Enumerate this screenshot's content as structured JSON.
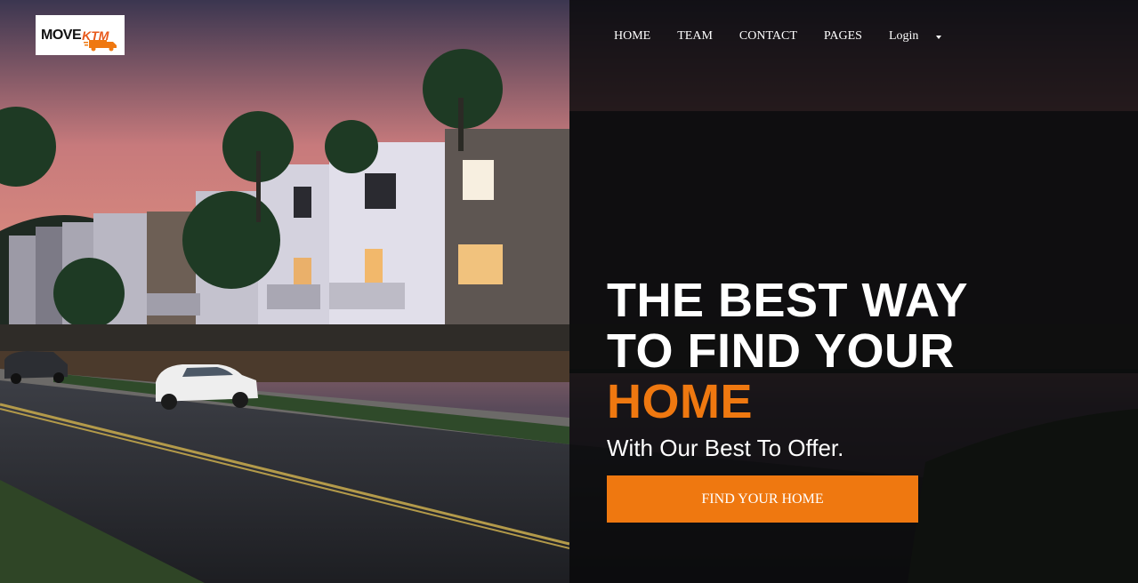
{
  "brand": {
    "logo_left": "MOVE",
    "logo_right": "KTM"
  },
  "nav": {
    "items": [
      "HOME",
      "TEAM",
      "CONTACT",
      "PAGES",
      "Login"
    ]
  },
  "hero": {
    "headline_line1": "THE BEST WAY",
    "headline_line2": "TO FIND YOUR",
    "headline_accent": "HOME",
    "subhead": "With Our Best To Offer.",
    "cta_label": "FIND YOUR HOME"
  },
  "colors": {
    "accent": "#ef7810",
    "overlay": "#08080a"
  },
  "icons": {
    "dropdown": "caret-down-icon"
  }
}
